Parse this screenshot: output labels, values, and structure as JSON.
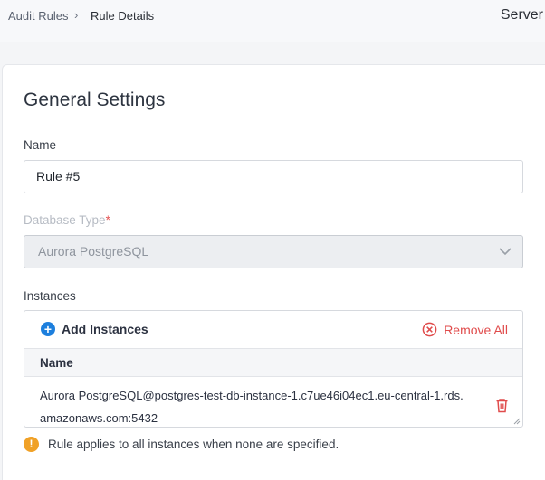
{
  "breadcrumb": {
    "items": [
      "Audit Rules",
      "Rule Details"
    ],
    "separator": "›"
  },
  "header": {
    "title": "Server"
  },
  "section": {
    "title": "General Settings"
  },
  "form": {
    "name_label": "Name",
    "name_value": "Rule #5",
    "db_type_label": "Database Type",
    "db_type_required_mark": "*",
    "db_type_value": "Aurora PostgreSQL",
    "instances_label": "Instances"
  },
  "instances": {
    "add_label": "Add Instances",
    "add_icon": "+",
    "remove_all_label": "Remove All",
    "column_header": "Name",
    "rows": [
      {
        "name": "Aurora PostgreSQL@postgres-test-db-instance-1.c7ue46i04ec1.eu-central-1.rds.amazonaws.com:5432"
      }
    ]
  },
  "hint": {
    "icon": "!",
    "text": "Rule applies to all instances when none are specified."
  },
  "colors": {
    "accent_blue": "#1d7fdd",
    "danger_red": "#e04b4b",
    "warning_orange": "#f0a127"
  }
}
